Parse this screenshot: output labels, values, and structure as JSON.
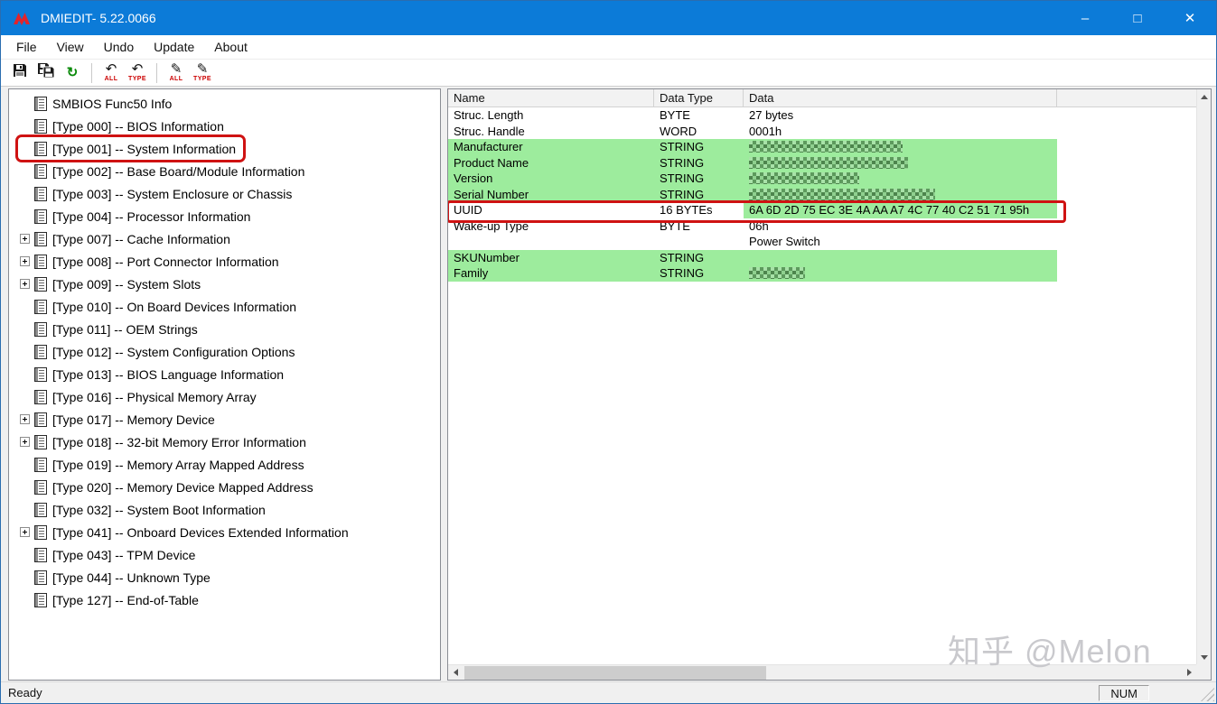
{
  "window": {
    "title": "DMIEDIT- 5.22.0066",
    "controls": {
      "minimize": "–",
      "maximize": "□",
      "close": "✕"
    }
  },
  "menu": {
    "items": [
      "File",
      "View",
      "Undo",
      "Update",
      "About"
    ]
  },
  "toolbar": {
    "buttons": [
      {
        "name": "save",
        "icon": "floppy-icon",
        "label": ""
      },
      {
        "name": "save-all",
        "icon": "floppy-multi-icon",
        "label": ""
      },
      {
        "name": "refresh",
        "icon": "refresh-icon",
        "label": ""
      },
      {
        "name": "undo-all",
        "icon": "undo-arrow-icon",
        "label": "ALL"
      },
      {
        "name": "undo-type",
        "icon": "undo-arrow-icon",
        "label": "TYPE"
      },
      {
        "name": "update-all",
        "icon": "pencil-icon",
        "label": "ALL"
      },
      {
        "name": "update-type",
        "icon": "pencil-icon",
        "label": "TYPE"
      }
    ],
    "glyphs": {
      "refresh": "↻",
      "undo": "↶",
      "pencil": "✎"
    }
  },
  "tree": {
    "root": "SMBIOS Func50 Info",
    "items": [
      {
        "label": "[Type 000] -- BIOS Information",
        "expandable": false,
        "annotated": false
      },
      {
        "label": "[Type 001] -- System Information",
        "expandable": false,
        "annotated": true
      },
      {
        "label": "[Type 002] -- Base Board/Module Information",
        "expandable": false,
        "annotated": false
      },
      {
        "label": "[Type 003] -- System Enclosure or Chassis",
        "expandable": false,
        "annotated": false
      },
      {
        "label": "[Type 004] -- Processor Information",
        "expandable": false,
        "annotated": false
      },
      {
        "label": "[Type 007] -- Cache Information",
        "expandable": true,
        "annotated": false
      },
      {
        "label": "[Type 008] -- Port Connector Information",
        "expandable": true,
        "annotated": false
      },
      {
        "label": "[Type 009] -- System Slots",
        "expandable": true,
        "annotated": false
      },
      {
        "label": "[Type 010] -- On Board Devices Information",
        "expandable": false,
        "annotated": false
      },
      {
        "label": "[Type 011] -- OEM Strings",
        "expandable": false,
        "annotated": false
      },
      {
        "label": "[Type 012] -- System Configuration Options",
        "expandable": false,
        "annotated": false
      },
      {
        "label": "[Type 013] -- BIOS Language Information",
        "expandable": false,
        "annotated": false
      },
      {
        "label": "[Type 016] -- Physical Memory Array",
        "expandable": false,
        "annotated": false
      },
      {
        "label": "[Type 017] -- Memory Device",
        "expandable": true,
        "annotated": false
      },
      {
        "label": "[Type 018] -- 32-bit Memory Error Information",
        "expandable": true,
        "annotated": false
      },
      {
        "label": "[Type 019] -- Memory Array Mapped Address",
        "expandable": false,
        "annotated": false
      },
      {
        "label": "[Type 020] -- Memory Device Mapped Address",
        "expandable": false,
        "annotated": false
      },
      {
        "label": "[Type 032] -- System Boot Information",
        "expandable": false,
        "annotated": false
      },
      {
        "label": "[Type 041] -- Onboard Devices Extended Information",
        "expandable": true,
        "annotated": false
      },
      {
        "label": "[Type 043] -- TPM Device",
        "expandable": false,
        "annotated": false
      },
      {
        "label": "[Type 044] -- Unknown Type",
        "expandable": false,
        "annotated": false
      },
      {
        "label": "[Type 127] -- End-of-Table",
        "expandable": false,
        "annotated": false
      }
    ]
  },
  "table": {
    "columns": [
      "Name",
      "Data Type",
      "Data"
    ],
    "rows": [
      {
        "name": "Struc. Length",
        "type": "BYTE",
        "data": "27 bytes",
        "bg": "white",
        "redacted": false,
        "annotated": false
      },
      {
        "name": "Struc. Handle",
        "type": "WORD",
        "data": "0001h",
        "bg": "white",
        "redacted": false,
        "annotated": false
      },
      {
        "name": "Manufacturer",
        "type": "STRING",
        "data": "",
        "bg": "green",
        "redacted": true,
        "redacted_width": 170,
        "annotated": false
      },
      {
        "name": "Product Name",
        "type": "STRING",
        "data": "",
        "bg": "green",
        "redacted": true,
        "redacted_width": 176,
        "annotated": false
      },
      {
        "name": "Version",
        "type": "STRING",
        "data": "",
        "bg": "green",
        "redacted": true,
        "redacted_width": 122,
        "annotated": false
      },
      {
        "name": "Serial Number",
        "type": "STRING",
        "data": "",
        "bg": "green",
        "redacted": true,
        "redacted_width": 206,
        "annotated": false
      },
      {
        "name": "UUID",
        "type": "16 BYTEs",
        "data": "6A 6D 2D 75 EC 3E 4A AA A7 4C 77 40 C2 51 71 95h",
        "bg": "data-green",
        "redacted": false,
        "annotated": true
      },
      {
        "name": "Wake-up Type",
        "type": "BYTE",
        "data": "06h",
        "bg": "white",
        "redacted": false,
        "annotated": false
      },
      {
        "name": "",
        "type": "",
        "data": "Power Switch",
        "bg": "white",
        "redacted": false,
        "annotated": false
      },
      {
        "name": "SKUNumber",
        "type": "STRING",
        "data": "",
        "bg": "green",
        "redacted": true,
        "redacted_width": 0,
        "annotated": false
      },
      {
        "name": "Family",
        "type": "STRING",
        "data": "",
        "bg": "green",
        "redacted": true,
        "redacted_width": 62,
        "annotated": false
      }
    ]
  },
  "statusbar": {
    "left": "Ready",
    "right": "NUM"
  },
  "watermark": "知乎 @Melon",
  "colors": {
    "titlebar": "#0c7bd8",
    "row_green": "#9dec9d",
    "annotation_red": "#cf1212",
    "logo_red": "#e3242b"
  }
}
